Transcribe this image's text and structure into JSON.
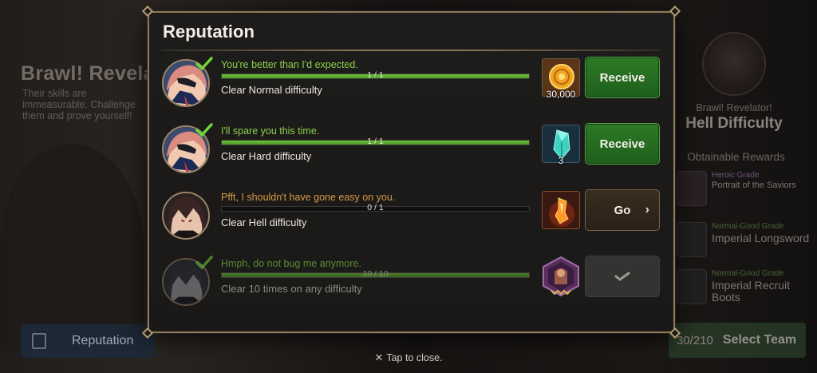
{
  "background": {
    "left_title": "Brawl! Revelator",
    "left_description": "Their skills are immeasurable. Challenge them and prove yourself!",
    "reputation_button": "Reputation",
    "right_subtitle": "Brawl! Revelator!",
    "right_title": "Hell Difficulty",
    "obtainable_rewards": "Obtainable Rewards",
    "rewards": [
      {
        "grade": "Heroic Grade",
        "name": "Portrait of the Saviors"
      },
      {
        "grade": "Normal-Good Grade",
        "name": "Imperial Longsword"
      },
      {
        "grade": "Normal-Good Grade",
        "name": "Imperial Recruit Boots"
      }
    ],
    "select_team": {
      "count": "30/210",
      "label": "Select Team"
    }
  },
  "modal": {
    "title": "Reputation",
    "tap_to_close": "Tap to close."
  },
  "missions": [
    {
      "quote": "You're better than I'd expected.",
      "progress_text": "1 / 1",
      "progress": 1.0,
      "task": "Clear Normal difficulty",
      "reward_icon": "gold-coin-icon",
      "reward_count": "30,000",
      "action": "Receive",
      "state": "complete"
    },
    {
      "quote": "I'll spare you this time.",
      "progress_text": "1 / 1",
      "progress": 1.0,
      "task": "Clear Hard difficulty",
      "reward_icon": "crystal-icon",
      "reward_count": "3",
      "action": "Receive",
      "state": "complete"
    },
    {
      "quote": "Pfft, I shouldn't have gone easy on you.",
      "progress_text": "0 / 1",
      "progress": 0.0,
      "task": "Clear Hell difficulty",
      "reward_icon": "flame-rune-icon",
      "reward_count": "",
      "action": "Go",
      "state": "in-progress"
    },
    {
      "quote": "Hmph, do not bug me anymore.",
      "progress_text": "10 / 10",
      "progress": 1.0,
      "task": "Clear 10 times on any difficulty",
      "reward_icon": "portrait-reward-icon",
      "reward_count": "",
      "action": "",
      "state": "claimed"
    }
  ]
}
